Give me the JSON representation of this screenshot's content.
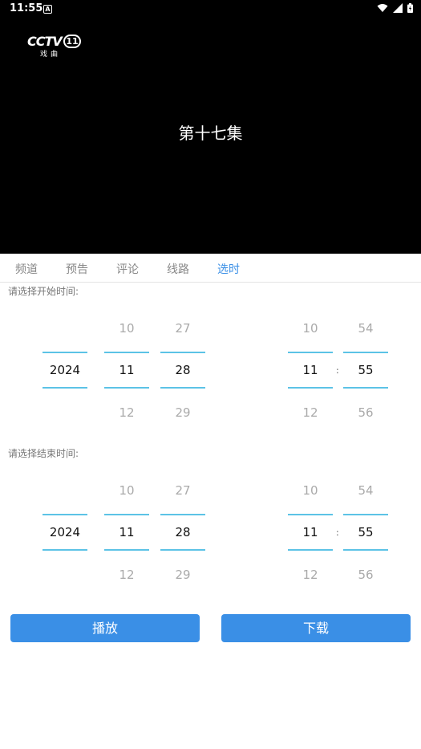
{
  "status_bar": {
    "time": "11:55",
    "notification_badge": "A",
    "icons": [
      "wifi-icon",
      "signal-icon",
      "battery-icon"
    ]
  },
  "player": {
    "logo_text": "CCTV",
    "logo_number": "11",
    "logo_sub": "戏曲",
    "episode_title": "第十七集"
  },
  "tabs": [
    {
      "label": "频道",
      "active": false
    },
    {
      "label": "预告",
      "active": false
    },
    {
      "label": "评论",
      "active": false
    },
    {
      "label": "线路",
      "active": false
    },
    {
      "label": "选时",
      "active": true
    }
  ],
  "start_time": {
    "label": "请选择开始时间:",
    "year": {
      "prev": "",
      "selected": "2024",
      "next": ""
    },
    "month": {
      "prev": "10",
      "selected": "11",
      "next": "12"
    },
    "day": {
      "prev": "27",
      "selected": "28",
      "next": "29"
    },
    "hour": {
      "prev": "10",
      "selected": "11",
      "next": "12"
    },
    "minute": {
      "prev": "54",
      "selected": "55",
      "next": "56"
    },
    "separator": ":"
  },
  "end_time": {
    "label": "请选择结束时间:",
    "year": {
      "prev": "",
      "selected": "2024",
      "next": ""
    },
    "month": {
      "prev": "10",
      "selected": "11",
      "next": "12"
    },
    "day": {
      "prev": "27",
      "selected": "28",
      "next": "29"
    },
    "hour": {
      "prev": "10",
      "selected": "11",
      "next": "12"
    },
    "minute": {
      "prev": "54",
      "selected": "55",
      "next": "56"
    },
    "separator": ":"
  },
  "actions": {
    "play_label": "播放",
    "download_label": "下载"
  },
  "colors": {
    "accent": "#3a8fe6",
    "picker_line": "#5cc3e6"
  }
}
